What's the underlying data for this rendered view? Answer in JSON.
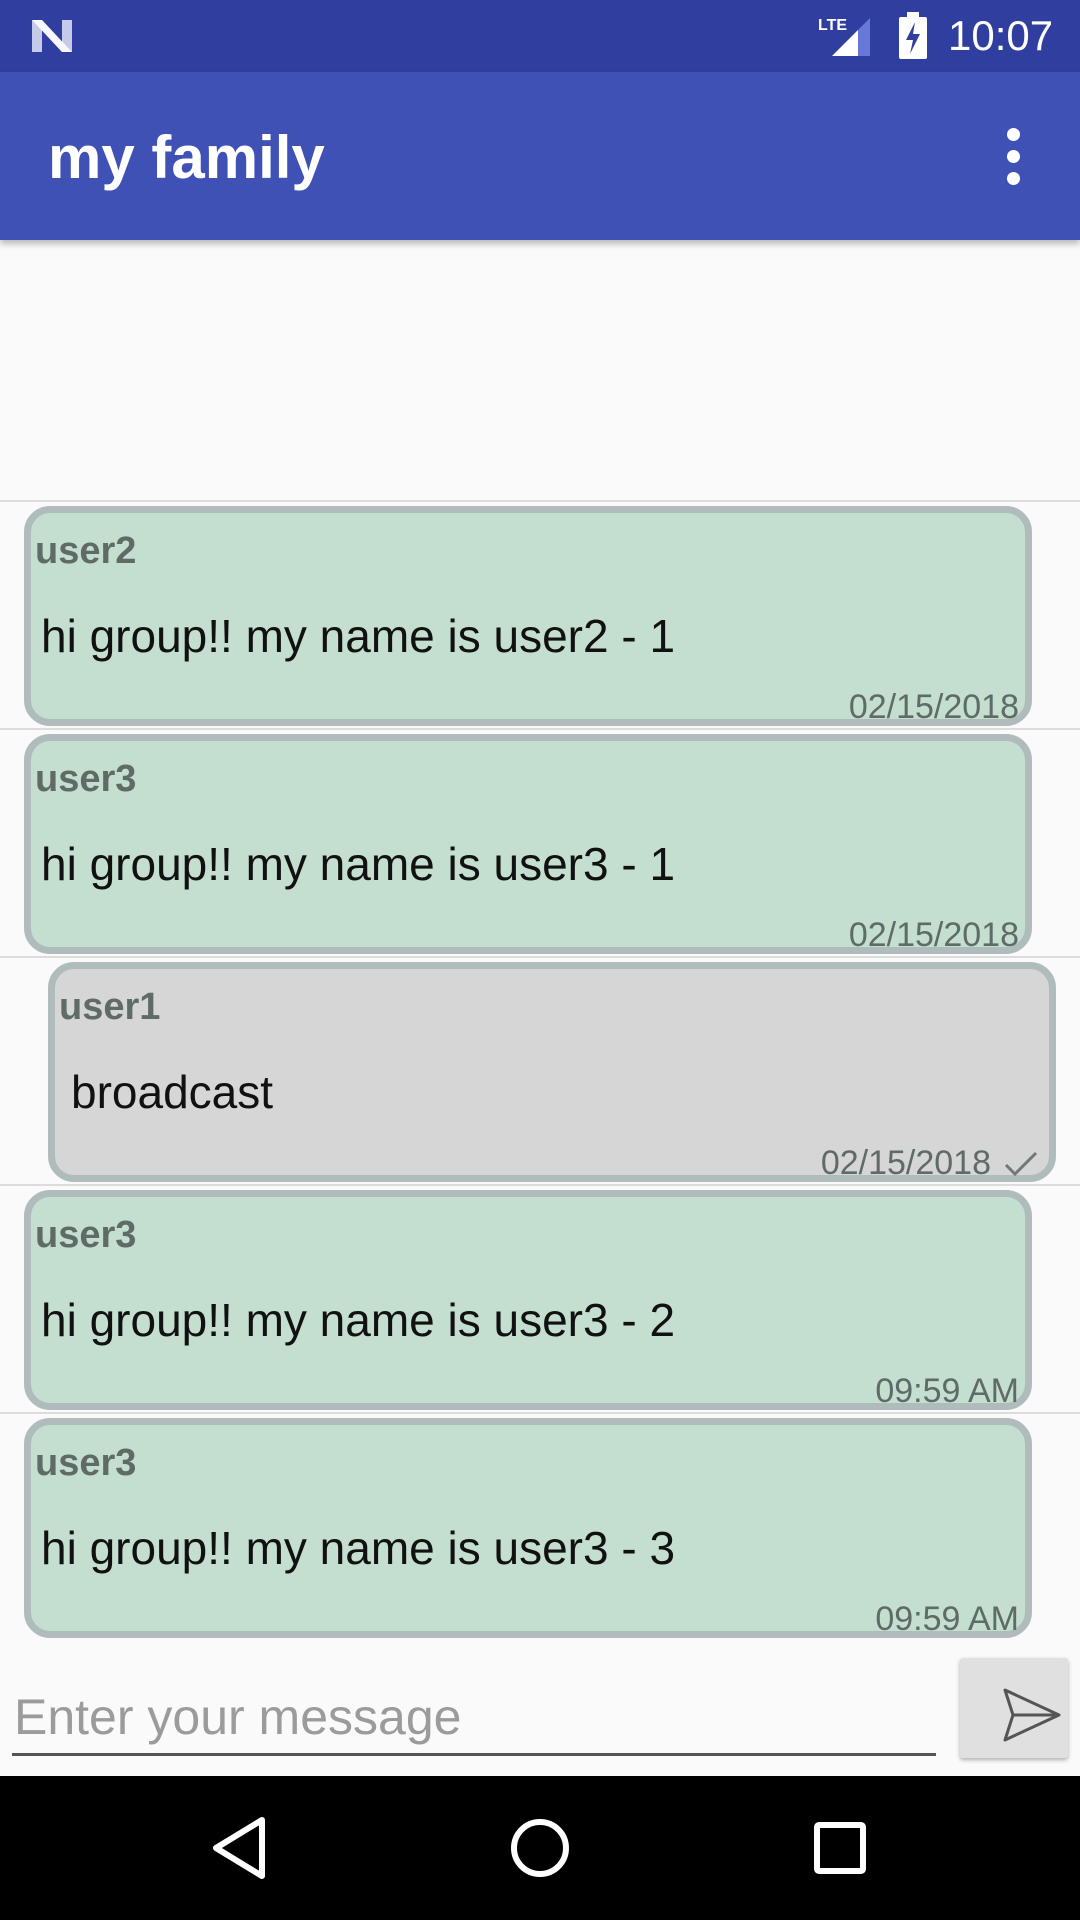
{
  "status_bar": {
    "network": "LTE",
    "time": "10:07",
    "icons": [
      "n-logo-icon",
      "lte-signal-icon",
      "battery-charging-icon"
    ]
  },
  "app_bar": {
    "title": "my family",
    "menu_icon": "more-vert-icon"
  },
  "messages": [
    {
      "sender": "user2",
      "text": "hi group!! my name is user2 - 1",
      "timestamp": "02/15/2018",
      "mine": false
    },
    {
      "sender": "user3",
      "text": "hi group!! my name is user3 - 1",
      "timestamp": "02/15/2018",
      "mine": false
    },
    {
      "sender": "user1",
      "text": "broadcast",
      "timestamp": "02/15/2018",
      "mine": true,
      "status_icon": "check-icon"
    },
    {
      "sender": "user3",
      "text": "hi group!! my name is user3 - 2",
      "timestamp": "09:59 AM",
      "mine": false
    },
    {
      "sender": "user3",
      "text": "hi group!! my name is user3 - 3",
      "timestamp": "09:59 AM",
      "mine": false
    }
  ],
  "composer": {
    "placeholder": "Enter your message",
    "value": "",
    "send_icon": "send-icon"
  },
  "nav_bar": {
    "icons": [
      "back-icon",
      "home-icon",
      "recents-icon"
    ]
  },
  "colors": {
    "status_bar": "#303f9f",
    "app_bar": "#3f51b5",
    "bubble_other": "#c4ded0",
    "bubble_mine": "#d6d6d6",
    "bubble_border": "#b0bcbc"
  }
}
